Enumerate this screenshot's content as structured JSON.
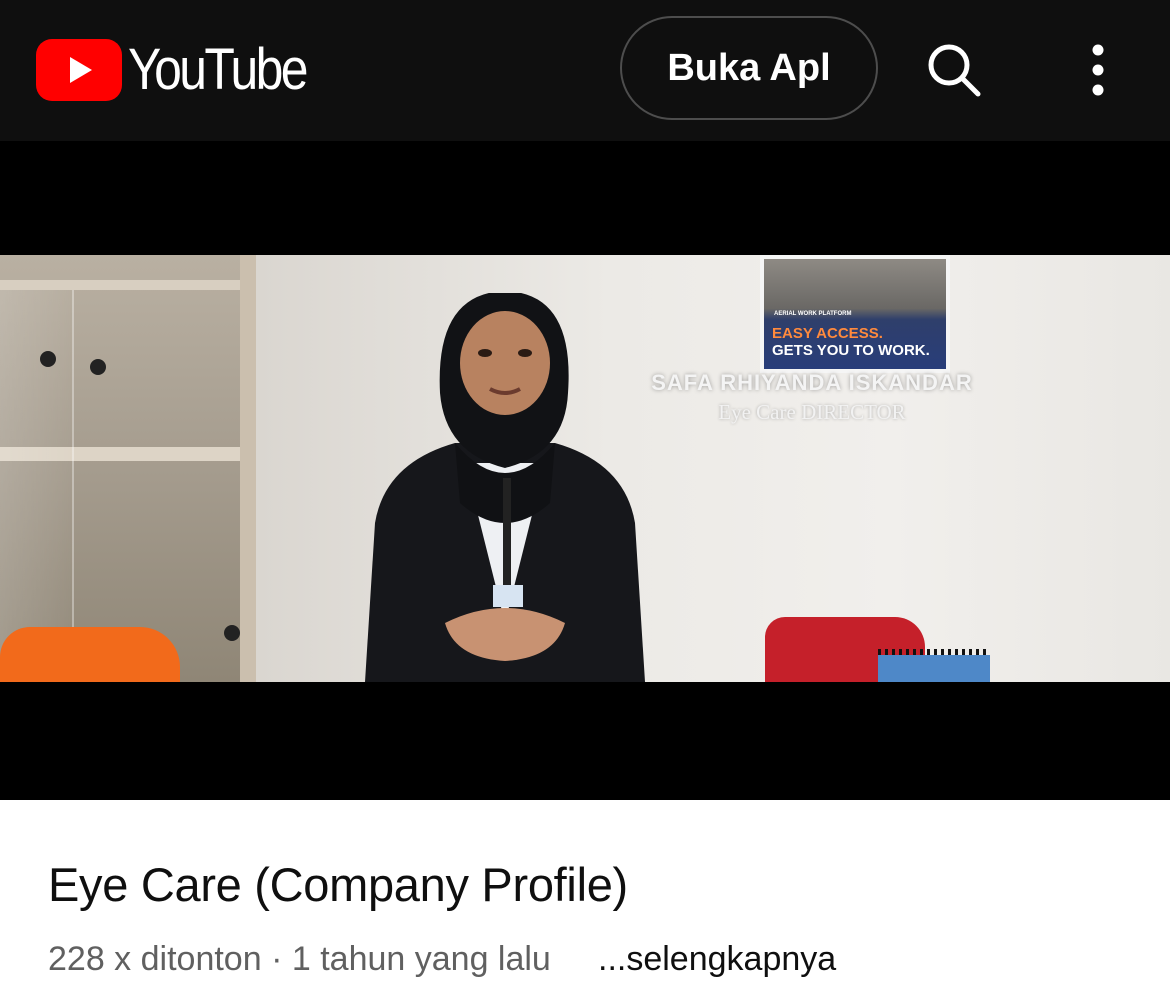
{
  "header": {
    "logo_text": "YouTube",
    "open_app_label": "Buka Apl",
    "search_icon": "search-icon",
    "menu_icon": "more-vert-icon"
  },
  "player": {
    "overlay": {
      "name": "SAFA RHIYANDA ISKANDAR",
      "role": "Eye Care DIRECTOR"
    },
    "poster": {
      "small_text": "AERIAL WORK PLATFORM",
      "headline_1": "EASY ACCESS.",
      "headline_2": "GETS YOU TO WORK."
    }
  },
  "video": {
    "title": "Eye Care (Company Profile)",
    "views": "228 x ditonton",
    "separator": "·",
    "age": "1 tahun yang lalu",
    "more_label": "...selengkapnya"
  },
  "colors": {
    "topbar_bg": "#0f0f0f",
    "brand_red": "#ff0000",
    "player_bg": "#000000",
    "meta_text": "#606060"
  }
}
